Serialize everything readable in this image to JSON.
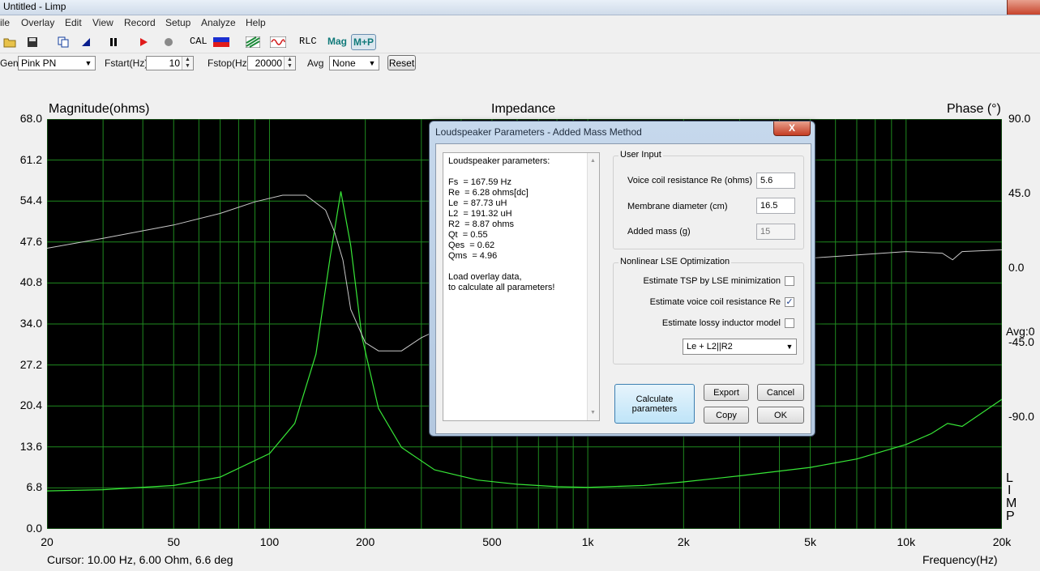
{
  "window": {
    "title": "Untitled - Limp"
  },
  "menu": [
    "ile",
    "Overlay",
    "Edit",
    "View",
    "Record",
    "Setup",
    "Analyze",
    "Help"
  ],
  "toolbar": {
    "cal": "CAL",
    "rlc": "RLC",
    "mag": "Mag",
    "mp": "M+P"
  },
  "gen": {
    "label": "Gen",
    "value": "Pink PN",
    "fstart_label": "Fstart(Hz)",
    "fstart_value": "10",
    "fstop_label": "Fstop(Hz)",
    "fstop_value": "20000",
    "avg_label": "Avg",
    "avg_value": "None",
    "reset": "Reset"
  },
  "plot": {
    "left_title": "Magnitude(ohms)",
    "center_title": "Impedance",
    "right_title": "Phase (°)",
    "avg_label": "Avg:0",
    "x_label": "Frequency(Hz)",
    "cursor": "Cursor: 10.00 Hz, 6.00 Ohm, 6.6 deg",
    "limp_letters": [
      "L",
      "I",
      "M",
      "P"
    ]
  },
  "chart_data": {
    "type": "line",
    "x_scale": "log",
    "xlim": [
      20,
      20000
    ],
    "ylim": [
      0,
      68
    ],
    "y2lim": [
      -157.5,
      90
    ],
    "x_ticks": [
      "20",
      "50",
      "100",
      "200",
      "500",
      "1k",
      "2k",
      "5k",
      "10k",
      "20k"
    ],
    "y_ticks": [
      "68.0",
      "61.2",
      "54.4",
      "47.6",
      "40.8",
      "34.0",
      "27.2",
      "20.4",
      "13.6",
      "6.8",
      "0.0"
    ],
    "y2_ticks": [
      "90.0",
      "45.0",
      "0.0",
      "-45.0",
      "-90.0"
    ],
    "grid": true,
    "series": [
      {
        "color": "#37e637",
        "x": [
          20,
          30,
          50,
          70,
          100,
          120,
          140,
          155,
          167.59,
          180,
          195,
          220,
          260,
          330,
          450,
          600,
          800,
          1000,
          1500,
          2000,
          3000,
          5000,
          7000,
          10000,
          12000,
          13500,
          15000,
          20000
        ],
        "y": [
          6.3,
          6.5,
          7.2,
          8.6,
          12.5,
          17.5,
          29,
          45,
          56,
          47,
          32,
          20,
          13.5,
          9.8,
          8.1,
          7.4,
          7.0,
          6.9,
          7.2,
          7.8,
          8.8,
          10.2,
          11.6,
          14.0,
          15.8,
          17.5,
          17.0,
          21.5
        ]
      },
      {
        "color": "#c8c8c8",
        "axis": "right",
        "x": [
          20,
          30,
          50,
          70,
          90,
          110,
          130,
          150,
          160,
          170,
          180,
          200,
          220,
          260,
          300,
          350,
          500,
          1000,
          2000,
          5000,
          10000,
          13000,
          14000,
          15000,
          20000
        ],
        "y": [
          12,
          18,
          26,
          33,
          40,
          44,
          44,
          35,
          22,
          5,
          -25,
          -45,
          -50,
          -50,
          -42,
          -36,
          -25,
          -10,
          0,
          6,
          10,
          9,
          5,
          10,
          11
        ]
      }
    ]
  },
  "dialog": {
    "title": "Loudspeaker Parameters - Added Mass Method",
    "close": "X",
    "params_lines": [
      "Loudspeaker parameters:",
      "",
      "Fs  = 167.59 Hz",
      "Re  = 6.28 ohms[dc]",
      "Le  = 87.73 uH",
      "L2  = 191.32 uH",
      "R2  = 8.87 ohms",
      "Qt  = 0.55",
      "Qes  = 0.62",
      "Qms  = 4.96",
      "",
      "Load overlay data,",
      "to calculate all parameters!"
    ],
    "user_input": {
      "legend": "User Input",
      "re_label": "Voice coil resistance Re (ohms)",
      "re_value": "5.6",
      "md_label": "Membrane diameter (cm)",
      "md_value": "16.5",
      "mass_label": "Added mass (g)",
      "mass_value": "15"
    },
    "nls": {
      "legend": "Nonlinear LSE Optimization",
      "opt1": "Estimate TSP by LSE minimization",
      "opt2": "Estimate voice coil resistance Re",
      "opt3": "Estimate lossy inductor model",
      "model": "Le + L2||R2"
    },
    "buttons": {
      "calculate": "Calculate parameters",
      "export": "Export",
      "cancel": "Cancel",
      "copy": "Copy",
      "ok": "OK"
    }
  }
}
